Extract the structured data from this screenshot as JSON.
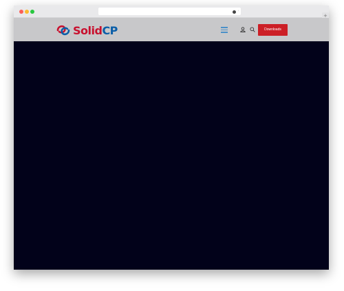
{
  "browser": {
    "reload_icon": "reload-icon",
    "extension_icon": "extension-icon",
    "new_tab_label": "+"
  },
  "header": {
    "logo": {
      "part1": "Solid",
      "part2": "CP"
    },
    "downloads_label": "Downloads",
    "menu_icon": "hamburger-menu-icon",
    "user_icon": "user-icon",
    "search_icon": "search-icon"
  },
  "colors": {
    "hero_background": "#02021a",
    "header_background": "#c8c8ca",
    "accent_red": "#cc1f26",
    "brand_blue": "#0a5ea8",
    "menu_blue": "#4a90c8"
  }
}
